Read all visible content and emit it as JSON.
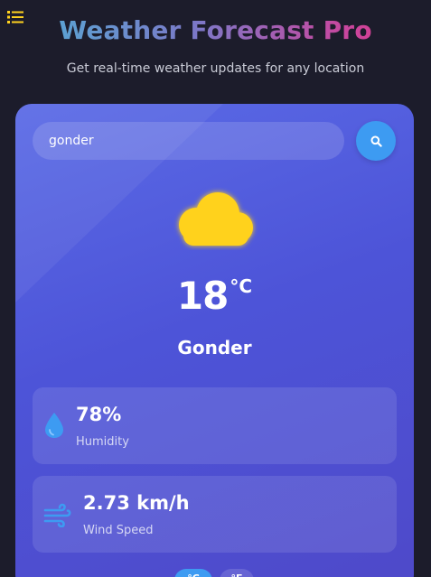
{
  "header": {
    "title": "Weather Forecast Pro",
    "subtitle": "Get real-time weather updates for any location",
    "menu_icon": "list-icon"
  },
  "search": {
    "value": "gonder",
    "button_icon": "search-icon"
  },
  "current": {
    "condition_icon": "cloud-icon",
    "temperature": "18",
    "unit": "°C",
    "city": "Gonder"
  },
  "stats": {
    "humidity": {
      "value": "78%",
      "label": "Humidity",
      "icon": "water-drop-icon"
    },
    "wind": {
      "value": "2.73 km/h",
      "label": "Wind Speed",
      "icon": "wind-icon"
    }
  },
  "unit_toggle": {
    "celsius_label": "°C",
    "fahrenheit_label": "°F"
  },
  "colors": {
    "background": "#1c1c2b",
    "card_start": "#5b6be6",
    "card_end": "#4e49c9",
    "accent": "#3d9bf2",
    "sun_cloud": "#ffd21f",
    "title_gradient_start": "#4fb2d6",
    "title_gradient_end": "#e3357f"
  }
}
